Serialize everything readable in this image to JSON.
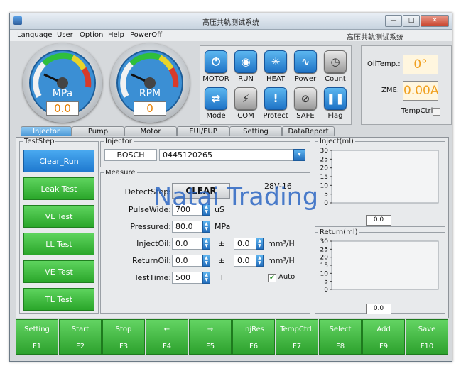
{
  "window": {
    "title": "高压共轨测试系统",
    "buttons": {
      "minimize": "—",
      "maximize": "□",
      "close": "✕"
    }
  },
  "menu": {
    "items": [
      "Language",
      "User",
      "Option",
      "Help",
      "PowerOff"
    ],
    "right_title": "高压共轨测试系统"
  },
  "gauges": [
    {
      "unit": "MPa",
      "value": "0.0",
      "level": 0
    },
    {
      "unit": "RPM",
      "value": "0",
      "level": 0
    }
  ],
  "icon_buttons": [
    {
      "label": "MOTOR",
      "icon": "power-icon",
      "glyph": "⏻"
    },
    {
      "label": "RUN",
      "icon": "record-icon",
      "glyph": "◉"
    },
    {
      "label": "HEAT",
      "icon": "sunburst-icon",
      "glyph": "✳"
    },
    {
      "label": "Power",
      "icon": "wave-icon",
      "glyph": "∿"
    },
    {
      "label": "Count",
      "icon": "stopwatch-icon",
      "glyph": "◷"
    },
    {
      "label": "Mode",
      "icon": "cycle-icon",
      "glyph": "⇄"
    },
    {
      "label": "COM",
      "icon": "plug-icon",
      "glyph": "⚡"
    },
    {
      "label": "Protect",
      "icon": "alert-icon",
      "glyph": "!"
    },
    {
      "label": "SAFE",
      "icon": "no-entry-icon",
      "glyph": "⊘"
    },
    {
      "label": "Flag",
      "icon": "pause-icon",
      "glyph": "❚❚"
    }
  ],
  "status": {
    "oiltemp_label": "OilTemp.:",
    "oiltemp_value": "0°",
    "zme_label": "ZME:",
    "zme_value": "0.00A",
    "tempctrl_label": "TempCtrl",
    "tempctrl_checked": false
  },
  "tabs": [
    "Injector",
    "Pump",
    "Motor",
    "EUI/EUP",
    "Setting",
    "DataReport"
  ],
  "active_tab": "Injector",
  "teststep": {
    "legend": "TestStep",
    "steps": [
      "Clear_Run",
      "Leak Test",
      "VL Test",
      "LL Test",
      "VE Test",
      "TL Test"
    ],
    "active": "Clear_Run"
  },
  "injector": {
    "legend": "Injector",
    "brand": "BOSCH",
    "part_number": "0445120265"
  },
  "measure": {
    "legend": "Measure",
    "detect_step_label": "DetectStep:",
    "detect_step_value": "CLEAR",
    "model": "28V-16",
    "pulse_wide_label": "PulseWide:",
    "pulse_wide_value": "700",
    "pulse_wide_unit": "uS",
    "pressured_label": "Pressured:",
    "pressured_value": "80.0",
    "pressured_unit": "MPa",
    "inject_oil_label": "InjectOil:",
    "inject_oil_value": "0.0",
    "inject_oil_tol": "0.0",
    "return_oil_label": "ReturnOil:",
    "return_oil_value": "0.0",
    "return_oil_tol": "0.0",
    "pm": "±",
    "oil_unit": "mm³/H",
    "test_time_label": "TestTime:",
    "test_time_value": "500",
    "test_time_unit": "T",
    "auto_label": "Auto",
    "auto_checked": true
  },
  "charts": [
    {
      "legend": "Inject(ml)",
      "ticks": [
        "30",
        "25",
        "20",
        "15",
        "10",
        "5",
        "0"
      ],
      "value": "0.0"
    },
    {
      "legend": "Return(ml)",
      "ticks": [
        "30",
        "25",
        "20",
        "15",
        "10",
        "5",
        "0"
      ],
      "value": "0.0"
    }
  ],
  "fkeys": [
    {
      "label": "Setting",
      "key": "F1"
    },
    {
      "label": "Start",
      "key": "F2"
    },
    {
      "label": "Stop",
      "key": "F3"
    },
    {
      "label": "←",
      "key": "F4"
    },
    {
      "label": "→",
      "key": "F5"
    },
    {
      "label": "InjRes",
      "key": "F6"
    },
    {
      "label": "TempCtrl.",
      "key": "F7"
    },
    {
      "label": "Select",
      "key": "F8"
    },
    {
      "label": "Add",
      "key": "F9"
    },
    {
      "label": "Save",
      "key": "F10"
    }
  ],
  "watermark": "Natai Trading",
  "colors": {
    "accent_blue": "#1f79cf",
    "green": "#2aa62a",
    "value_orange": "#f0a020"
  }
}
